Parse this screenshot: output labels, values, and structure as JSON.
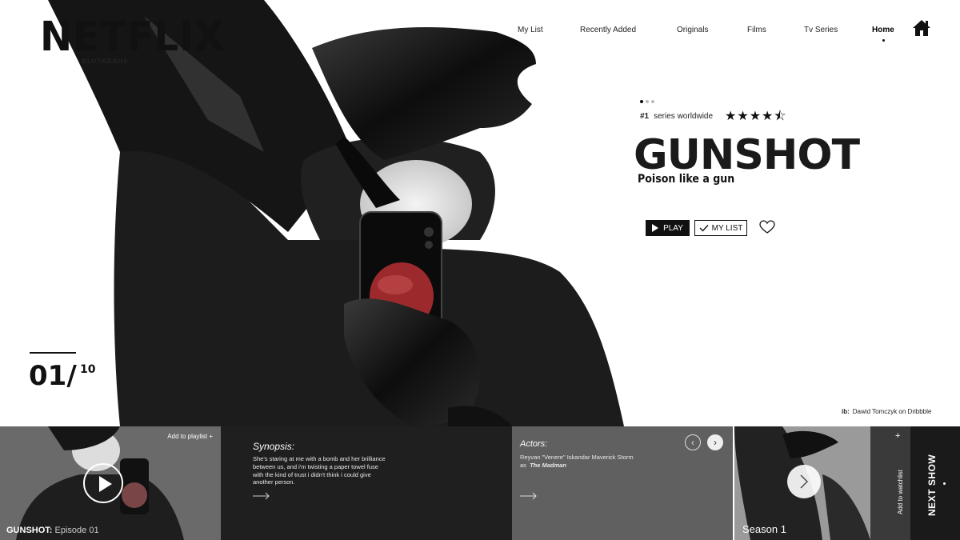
{
  "brand": {
    "logo": "NETFLIX",
    "sub": "BLUTKRAHE"
  },
  "nav": {
    "items": [
      "My List",
      "Recently Added",
      "Originals",
      "Films",
      "Tv Series",
      "Home"
    ],
    "active": "Home",
    "home_icon": "home-icon"
  },
  "show": {
    "rank_num": "#1",
    "rank_text": "series worldwide",
    "rating": 4.5,
    "stars": "★★★★⯪",
    "title": "GUNSHOT",
    "tagline": "Poison like a gun",
    "play_label": "PLAY",
    "mylist_label": "MY LIST"
  },
  "counter": {
    "current": "01/",
    "total": "10"
  },
  "credit": {
    "prefix": "ib:",
    "text": "Dawid Tomczyk on Dribbble"
  },
  "strip": {
    "add_playlist": "Add to playlist  +",
    "episode_show": "GUNSHOT:",
    "episode_label": "Episode 01",
    "synopsis_title": "Synopsis:",
    "synopsis_body": "She's staring at me with a bomb and her brilliance between us, and i'm twisting a paper towel fuse with the kind of trust i didn't think i could give another person.",
    "actors_title": "Actors:",
    "actor_name": "Reyvan \"Venere\" Iskandar Maverick Storm",
    "actor_as": "as",
    "actor_role": "The Madman",
    "season_label": "Season 1",
    "watchlist_label": "Add to watchlist",
    "watchlist_plus": "+",
    "next_show": "NEXT SHOW"
  },
  "colors": {
    "ink": "#111111",
    "accent_red": "#9c2a2c"
  }
}
